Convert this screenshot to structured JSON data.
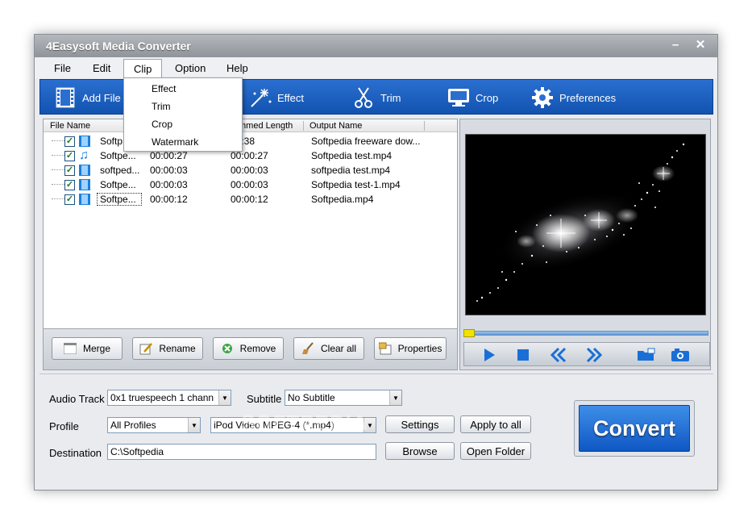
{
  "app": {
    "title": "4Easysoft Media Converter"
  },
  "window_controls": {
    "minimize": "minimize-icon",
    "close": "close-icon"
  },
  "menubar": {
    "file": "File",
    "edit": "Edit",
    "clip": "Clip",
    "option": "Option",
    "help": "Help"
  },
  "clip_menu": {
    "items": [
      "Effect",
      "Trim",
      "Crop",
      "Watermark"
    ]
  },
  "toolbar": {
    "add_file": "Add File",
    "effect": "Effect",
    "trim": "Trim",
    "crop": "Crop",
    "preferences": "Preferences"
  },
  "file_list": {
    "columns": {
      "name": "File Name",
      "length": "mmed Length",
      "output": "Output Name"
    },
    "rows": [
      {
        "name": "Softp",
        "duration": "",
        "trimmed": "02:38",
        "output": "Softpedia freeware dow...",
        "icon": "video-file-icon"
      },
      {
        "name": "Softpe...",
        "duration": "00:00:27",
        "trimmed": "00:00:27",
        "output": "Softpedia test.mp4",
        "icon": "audio-file-icon"
      },
      {
        "name": "softped...",
        "duration": "00:00:03",
        "trimmed": "00:00:03",
        "output": "softpedia test.mp4",
        "icon": "video-file-icon"
      },
      {
        "name": "Softpe...",
        "duration": "00:00:03",
        "trimmed": "00:00:03",
        "output": "Softpedia test-1.mp4",
        "icon": "video-file-icon"
      },
      {
        "name": "Softpe...",
        "duration": "00:00:12",
        "trimmed": "00:00:12",
        "output": "Softpedia.mp4",
        "icon": "video-file-icon"
      }
    ]
  },
  "list_buttons": {
    "merge": "Merge",
    "rename": "Rename",
    "remove": "Remove",
    "clear_all": "Clear all",
    "properties": "Properties"
  },
  "settings": {
    "audio_track_label": "Audio Track",
    "audio_track_value": "0x1 truespeech 1 chann",
    "subtitle_label": "Subtitle",
    "subtitle_value": "No Subtitle",
    "profile_label": "Profile",
    "profile_category": "All Profiles",
    "profile_value": "iPod Video MPEG-4 (*.mp4)",
    "settings_button": "Settings",
    "apply_all_button": "Apply to all",
    "destination_label": "Destination",
    "destination_value": "C:\\Softpedia",
    "browse_button": "Browse",
    "open_folder_button": "Open Folder",
    "convert_button": "Convert"
  },
  "watermark": "SOFTPEDIA",
  "colors": {
    "toolbar": "#1a5fc2",
    "convert": "#1565d2",
    "seek_knob": "#f2e200"
  }
}
